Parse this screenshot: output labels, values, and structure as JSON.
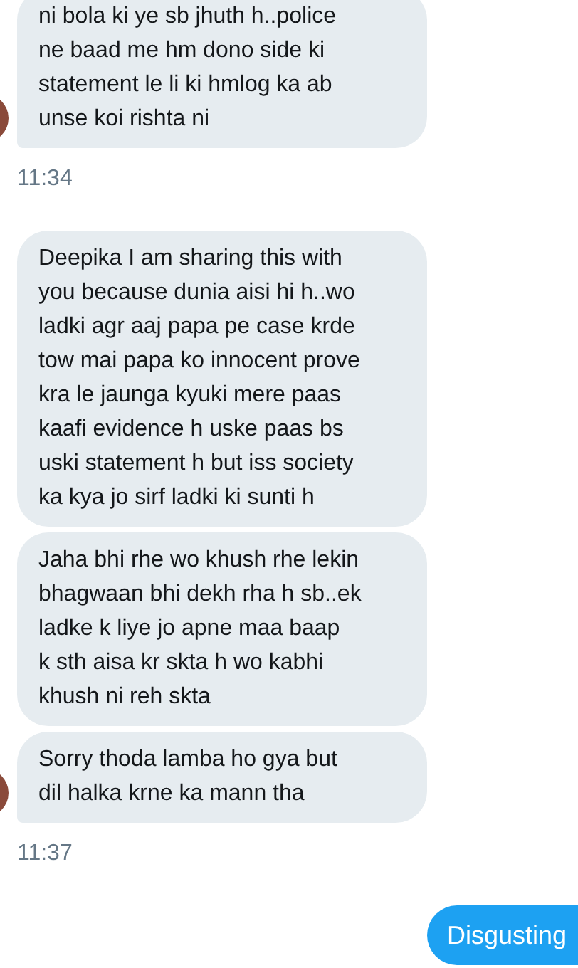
{
  "groups": [
    {
      "kind": "received",
      "bubbles": [
        "ni bola ki ye sb jhuth h..police\nne baad me hm dono side ki\nstatement le li ki hmlog ka ab\nunse koi rishta ni"
      ],
      "time": "11:34"
    },
    {
      "kind": "received",
      "bubbles": [
        "Deepika I am sharing this with\nyou because dunia aisi hi h..wo\nladki agr aaj papa pe case krde\ntow mai papa ko innocent prove\nkra le jaunga kyuki mere paas\nkaafi evidence h uske paas bs\nuski statement h but iss society\nka kya jo sirf ladki ki sunti h",
        "Jaha bhi rhe wo khush rhe lekin\nbhagwaan bhi dekh rha h sb..ek\nladke k liye jo apne maa baap\nk sth aisa kr skta h wo kabhi\nkhush ni reh skta",
        "Sorry thoda lamba ho gya but\ndil halka krne ka mann tha"
      ],
      "time": "11:37"
    },
    {
      "kind": "sent",
      "bubbles": [
        "Disgusting"
      ]
    }
  ]
}
